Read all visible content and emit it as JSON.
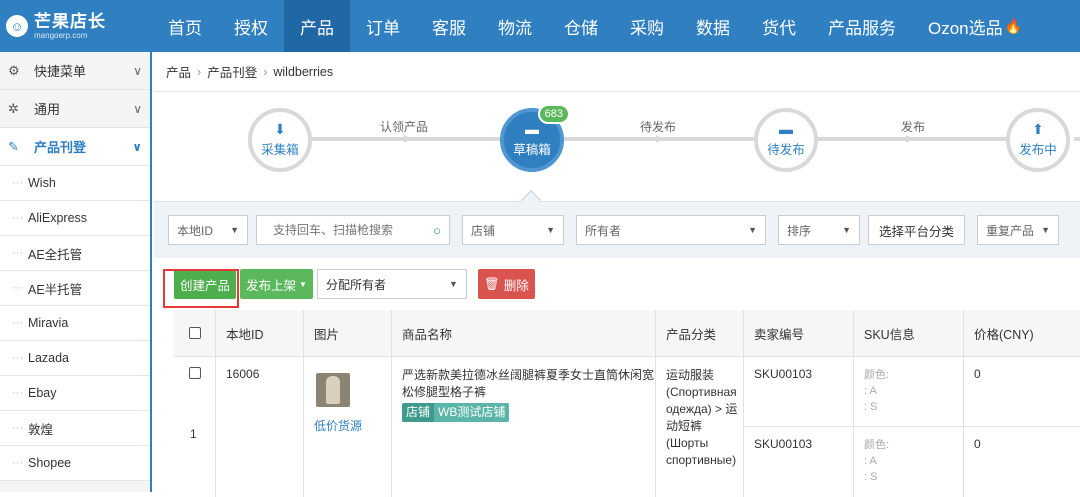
{
  "brand": {
    "name": "芒果店长",
    "domain": "mangoerp.com"
  },
  "nav": [
    "首页",
    "授权",
    "产品",
    "订单",
    "客服",
    "物流",
    "仓储",
    "采购",
    "数据",
    "货代",
    "产品服务",
    "Ozon选品"
  ],
  "nav_active_index": 2,
  "sidebar": {
    "sections": [
      {
        "label": "快捷菜单"
      },
      {
        "label": "通用"
      },
      {
        "label": "产品刊登"
      }
    ],
    "items": [
      "Wish",
      "AliExpress",
      "AE全托管",
      "AE半托管",
      "Miravia",
      "Lazada",
      "Ebay",
      "敦煌",
      "Shopee"
    ]
  },
  "breadcrumb": [
    "产品",
    "产品刊登",
    "wildberries"
  ],
  "workflow": {
    "steps": [
      {
        "label": "采集箱"
      },
      {
        "label": "草稿箱",
        "badge": "683"
      },
      {
        "label": "待发布"
      },
      {
        "label": "发布中"
      }
    ],
    "transitions": [
      "认领产品",
      "待发布",
      "发布"
    ]
  },
  "filters": {
    "id_select": "本地ID",
    "search_placeholder": "支持回车、扫描枪搜索",
    "shop": "店铺",
    "owner": "所有者",
    "sort": "排序",
    "category_button": "选择平台分类",
    "duplicate": "重复产品"
  },
  "actions": {
    "create": "创建产品",
    "publish": "发布上架",
    "assign_owner": "分配所有者",
    "delete": "删除"
  },
  "table": {
    "headers": [
      "本地ID",
      "图片",
      "商品名称",
      "产品分类",
      "卖家编号",
      "SKU信息",
      "价格(CNY)"
    ],
    "rows": [
      {
        "index": "1",
        "local_id": "16006",
        "image_link": "低价货源",
        "name": "严选新款美拉德冰丝阔腿裤夏季女士直筒休闲宽松修腿型格子裤",
        "tags": [
          "店铺",
          "WB测试店铺"
        ],
        "category": "运动服装 (Спортивная одежда) > 运动短裤 (Шорты спортивные)",
        "skus": [
          {
            "code": "SKU00103",
            "color_label": "颜色:",
            "a": ": A",
            "s": ": S",
            "price": "0"
          },
          {
            "code": "SKU00103",
            "color_label": "颜色:",
            "a": ": A",
            "s": ": S",
            "price": "0"
          }
        ]
      }
    ]
  },
  "colors": {
    "primary": "#2f7fc1",
    "nav_active": "#1f67a5",
    "green": "#4cae4c",
    "red": "#d9534f",
    "badge": "#5cb85c",
    "highlight_box": "#e53935"
  }
}
